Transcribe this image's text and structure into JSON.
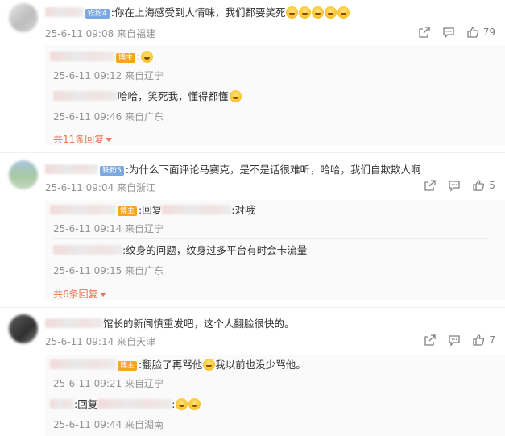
{
  "comments": [
    {
      "level": "铁粉4",
      "text": ":你在上海感受到人情味，我们都要笑死",
      "time": "25-6-11 09:08 来自福建",
      "likes": "79",
      "replies": [
        {
          "badge": "博主",
          "text": ":",
          "time": "25-6-11 09:12 来自辽宁"
        },
        {
          "text": "哈哈，笑死我，懂得都懂",
          "time": "25-6-11 09:46 来自广东"
        }
      ],
      "more": "共11条回复"
    },
    {
      "level": "铁粉5",
      "text": ":为什么下面评论马赛克，是不是话很难听，哈哈，我们自欺欺人啊",
      "time": "25-6-11 09:04 来自浙江",
      "likes": "5",
      "replies": [
        {
          "badge": "博主",
          "prefix": ":回复",
          "text": ":对哦",
          "time": "25-6-11 09:14 来自辽宁"
        },
        {
          "text": ":纹身的问题，纹身过多平台有时会卡流量",
          "time": "25-6-11 09:15 来自广东"
        }
      ],
      "more": "共6条回复"
    },
    {
      "text": "馆长的新闻慎重发吧，这个人翻脸很快的。",
      "time": "25-6-11 09:14 来自天津",
      "likes": "7",
      "replies": [
        {
          "badge": "博主",
          "text": ":翻脸了再骂他",
          "text2": "我以前也没少骂他。",
          "time": "25-6-11 09:21 来自辽宁"
        },
        {
          "prefix": ":回复",
          "text": ":",
          "time": "25-6-11 09:44 来自湖南"
        }
      ]
    }
  ],
  "colors": {
    "accent": "#eb7350",
    "fan_badge": "#7aa8e0",
    "author_badge": "#f7a32a",
    "meta": "#939393"
  },
  "icons": [
    "share-icon",
    "comment-icon",
    "like-icon",
    "caret-down-icon",
    "laugh-emoji"
  ]
}
